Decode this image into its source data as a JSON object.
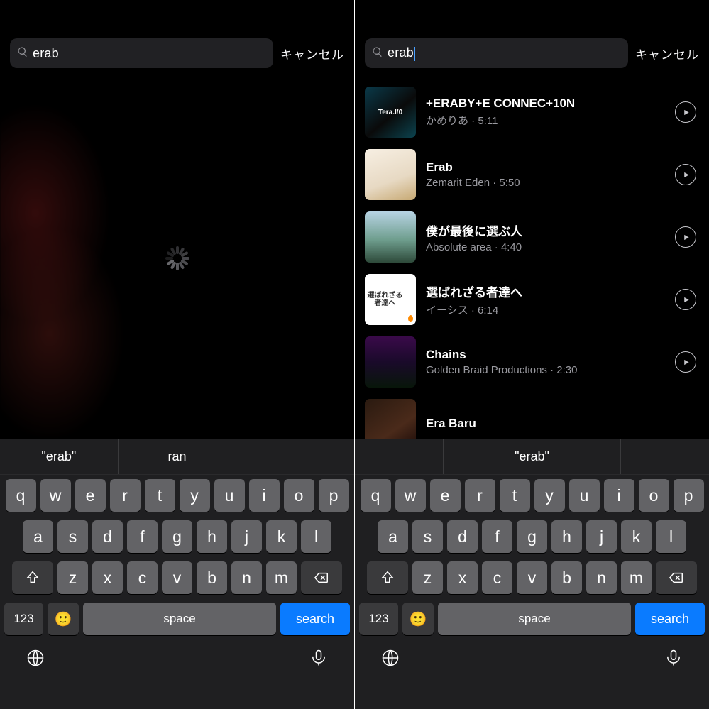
{
  "left": {
    "search_query": "erab",
    "cancel_label": "キャンセル",
    "state": "loading",
    "suggestions": [
      "\"erab\"",
      "ran"
    ]
  },
  "right": {
    "search_query": "erab",
    "cancel_label": "キャンセル",
    "suggestions": [
      "\"erab\""
    ],
    "results": [
      {
        "title": "+ERABY+E CONNEC+10N",
        "artist": "かめりあ",
        "duration": "5:11",
        "thumb": {
          "bg": "linear-gradient(140deg,#0a3a4a 0%,#0a0a0a 55%,#0b434f 100%)",
          "label": "Tera.I/0"
        }
      },
      {
        "title": "Erab",
        "artist": "Zemarit Eden",
        "duration": "5:50",
        "thumb": {
          "bg": "linear-gradient(160deg,#f7efe3 0%,#e7d9c3 60%,#c7a973 100%)",
          "label": ""
        }
      },
      {
        "title": "僕が最後に選ぶ人",
        "artist": "Absolute area",
        "duration": "4:40",
        "thumb": {
          "bg": "linear-gradient(180deg,#b7d3e3 0%,#6f9e8e 55%,#2e4a3a 100%)",
          "label": ""
        }
      },
      {
        "title": "選ばれざる者達へ",
        "artist": "イーシス",
        "duration": "6:14",
        "thumb": {
          "bg": "#ffffff",
          "label": "選ばれざる者達へ",
          "label_color": "#333",
          "dot": "#ff8a00"
        }
      },
      {
        "title": "Chains",
        "artist": "Golden Braid Productions",
        "duration": "2:30",
        "thumb": {
          "bg": "linear-gradient(180deg,#3a0a4a 0%,#1a0a2a 50%,#08160a 100%)",
          "label": ""
        }
      },
      {
        "title": "Era Baru",
        "artist": "",
        "duration": "",
        "thumb": {
          "bg": "linear-gradient(145deg,#2a1a10 0%,#4a2a1a 60%,#1a0a08 100%)",
          "label": ""
        }
      }
    ]
  },
  "keyboard": {
    "row1": [
      "q",
      "w",
      "e",
      "r",
      "t",
      "y",
      "u",
      "i",
      "o",
      "p"
    ],
    "row2": [
      "a",
      "s",
      "d",
      "f",
      "g",
      "h",
      "j",
      "k",
      "l"
    ],
    "row3": [
      "z",
      "x",
      "c",
      "v",
      "b",
      "n",
      "m"
    ],
    "num_key": "123",
    "space_key": "space",
    "search_key": "search"
  }
}
